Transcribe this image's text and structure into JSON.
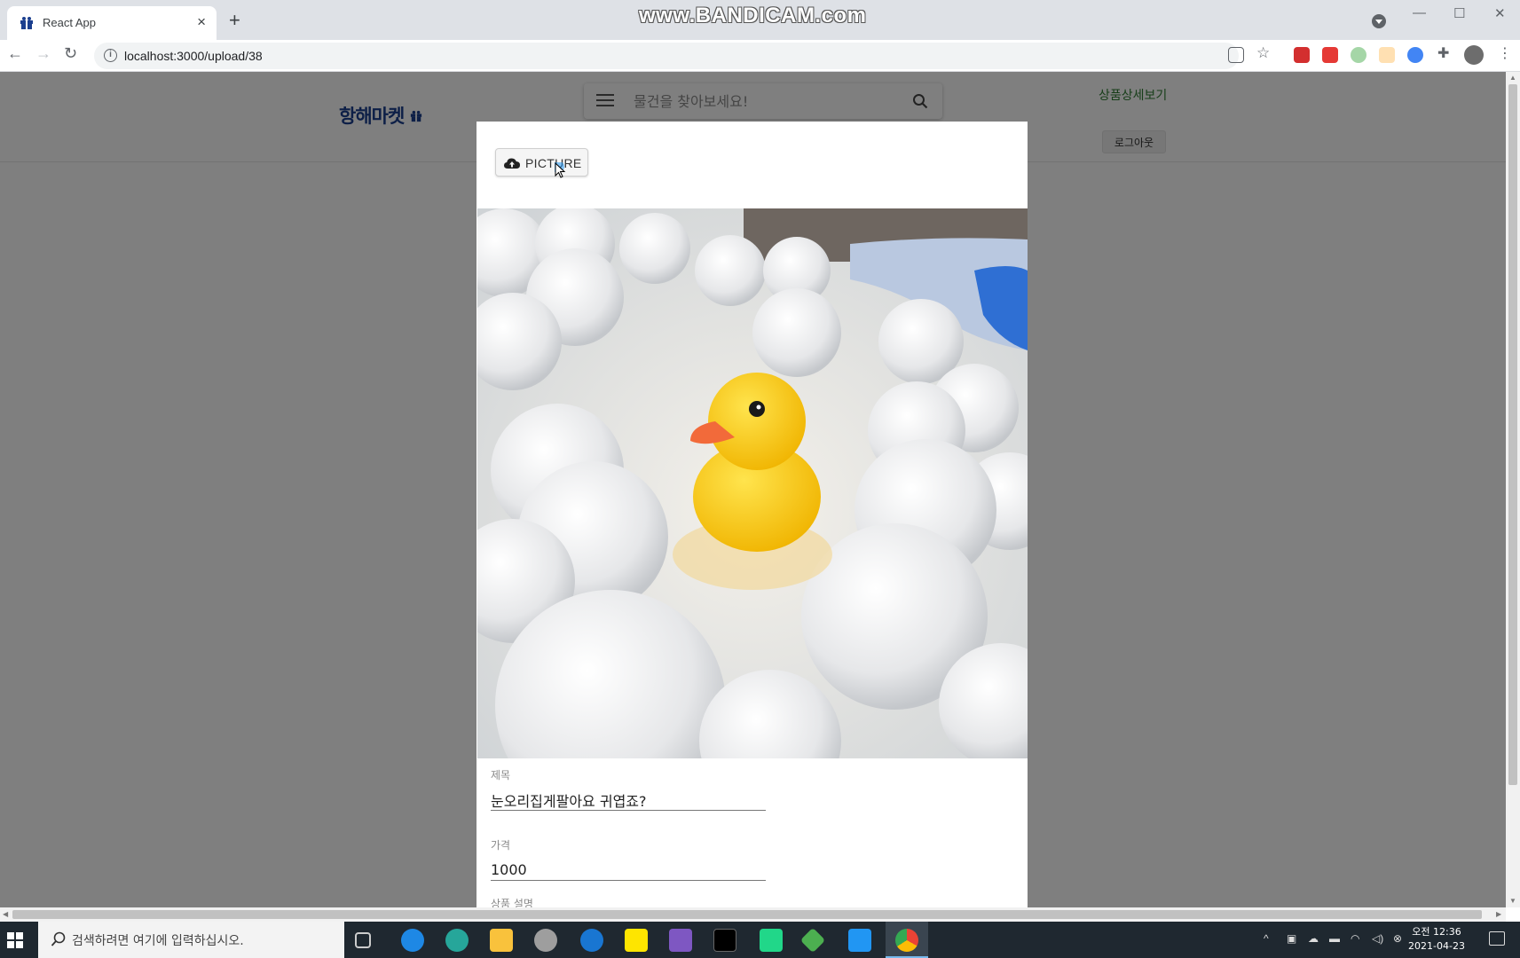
{
  "browser": {
    "tab_title": "React App",
    "tab_close": "×",
    "new_tab": "+",
    "url": "localhost:3000/upload/38",
    "watermark": "www.BANDICAM.com",
    "back": "←",
    "forward": "→",
    "reload": "↻",
    "minimize": "—",
    "maximize": "☐",
    "close": "✕"
  },
  "header": {
    "logo": "항해마켓",
    "search_placeholder": "물건을 찾아보세요!",
    "detail_link": "상품상세보기",
    "logout": "로그아웃"
  },
  "modal": {
    "upload_button": "PICTURE",
    "fields": [
      {
        "label": "제목",
        "value": "눈오리집게팔아요 귀엽죠?"
      },
      {
        "label": "가격",
        "value": "1000"
      },
      {
        "label": "상품 설명",
        "value": ""
      }
    ]
  },
  "taskbar": {
    "search_placeholder": "검색하려면 여기에 입력하십시오.",
    "time": "오전 12:36",
    "date": "2021-04-23"
  },
  "colors": {
    "logo": "#1b3f8f",
    "link": "#2e7d32",
    "duck": "#f8c90f",
    "beak": "#f26a3a"
  }
}
